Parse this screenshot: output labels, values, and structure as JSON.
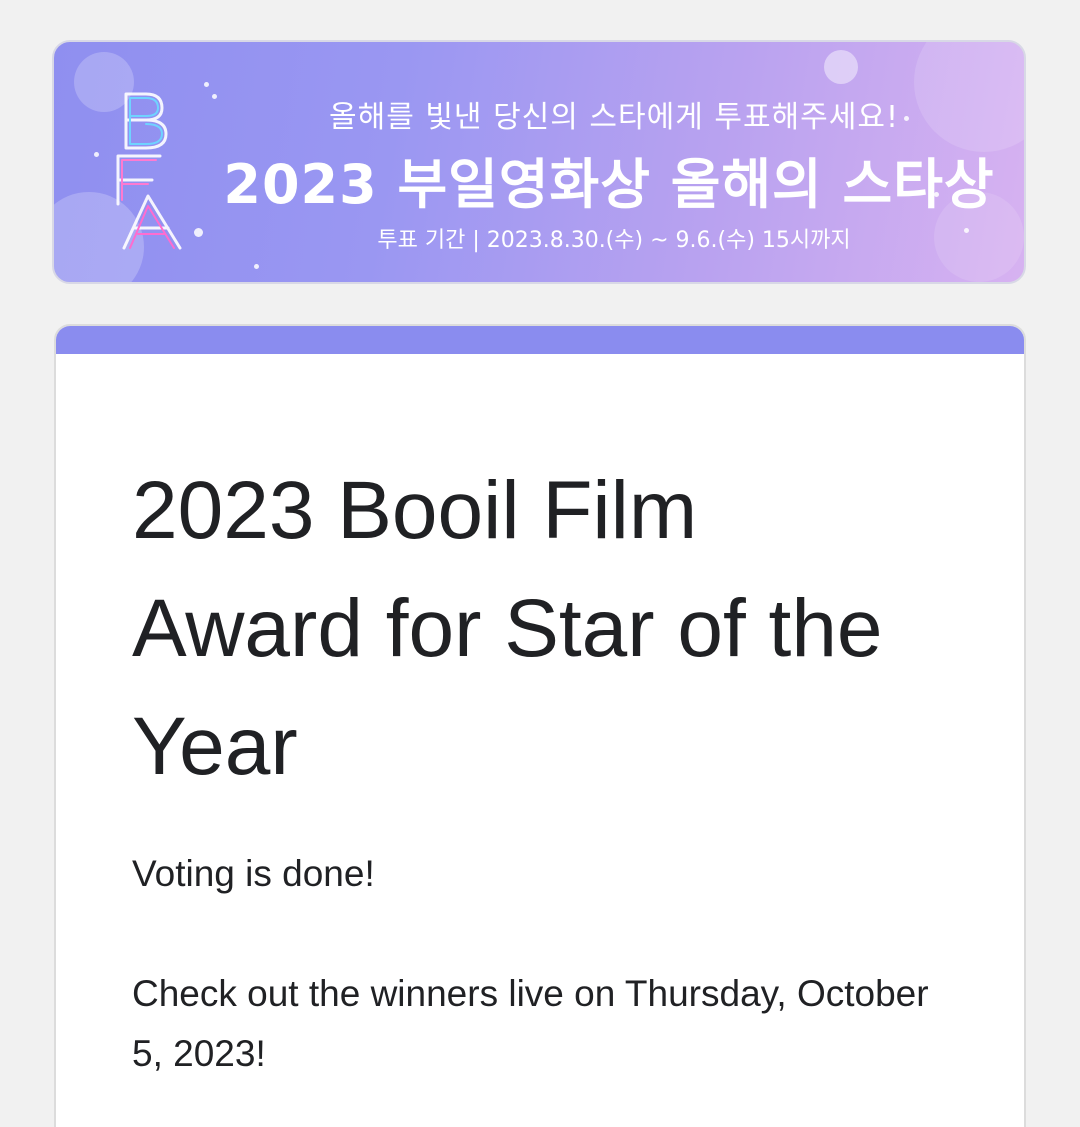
{
  "banner": {
    "logo_text": "BFA",
    "subtitle": "올해를 빛낸 당신의 스타에게 투표해주세요!",
    "title": "2023 부일영화상 올해의 스타상",
    "period": "투표 기간 | 2023.8.30.(수) ~ 9.6.(수) 15시까지",
    "colors": {
      "gradient_start": "#8f8ff0",
      "gradient_end": "#d7b2f1"
    }
  },
  "form": {
    "accent_color": "#8a8cef",
    "title": "2023 Booil Film Award for Star of the Year",
    "description": [
      "Voting is done!",
      "Check out the winners live on Thursday, October 5, 2023!"
    ]
  }
}
